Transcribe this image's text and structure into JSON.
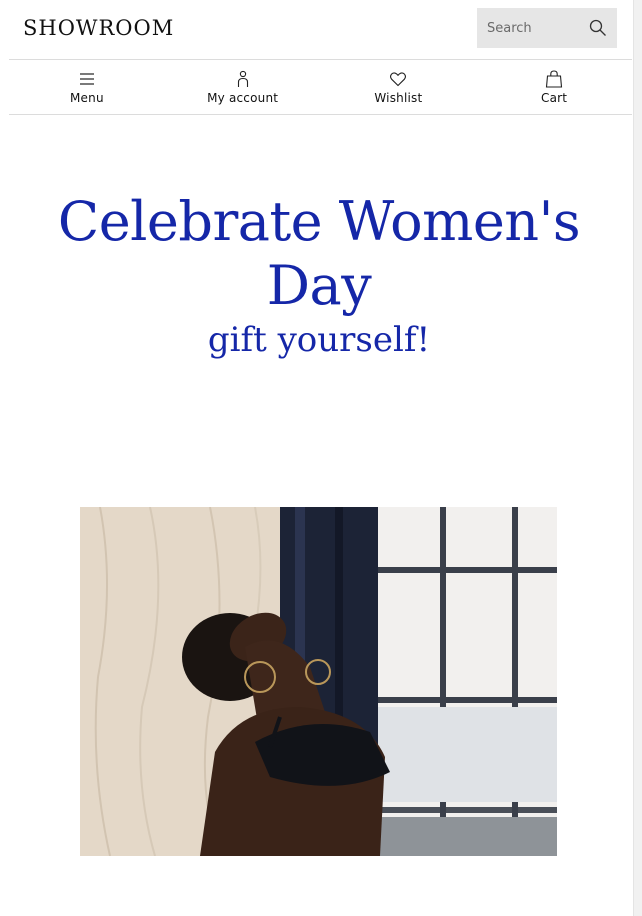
{
  "header": {
    "logo_text": "SHOWROOM",
    "search_placeholder": "Search"
  },
  "nav": {
    "items": [
      {
        "label": "Menu",
        "icon": "menu-icon"
      },
      {
        "label": "My account",
        "icon": "account-icon"
      },
      {
        "label": "Wishlist",
        "icon": "heart-icon"
      },
      {
        "label": "Cart",
        "icon": "bag-icon"
      }
    ]
  },
  "hero": {
    "title": "Celebrate Women's Day",
    "subtitle": "gift yourself!"
  },
  "colors": {
    "accent": "#1527a8",
    "search_bg": "#e6e6e6",
    "divider": "#dcdcdc"
  }
}
